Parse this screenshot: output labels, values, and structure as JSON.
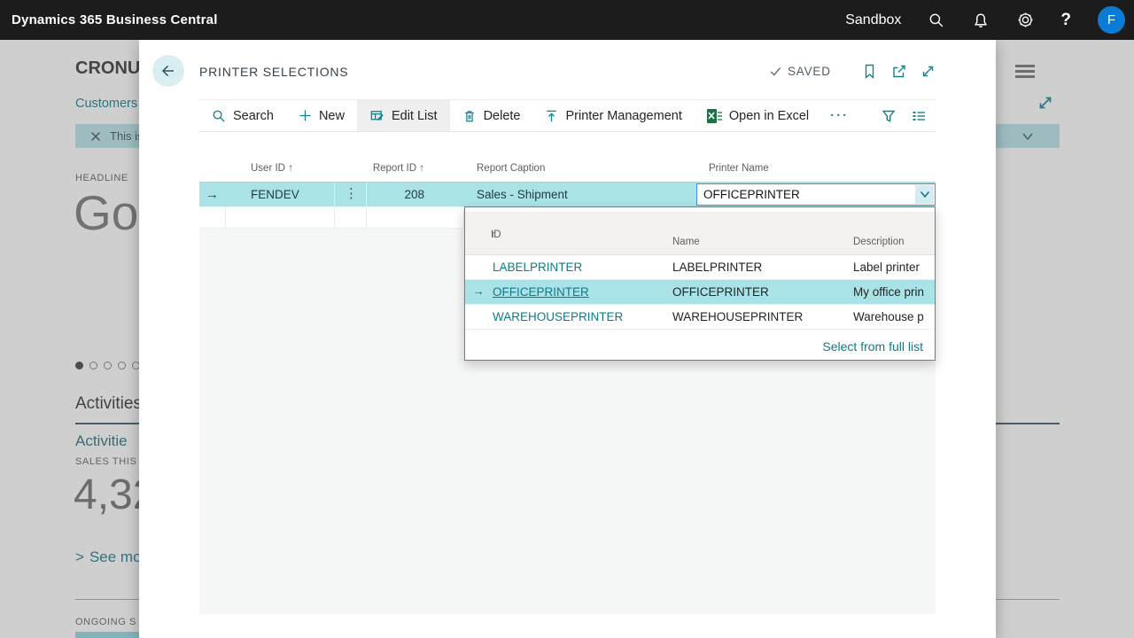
{
  "topbar": {
    "app_title": "Dynamics 365 Business Central",
    "environment": "Sandbox",
    "avatar_initial": "F",
    "icons": [
      "search-icon",
      "notifications-bell-icon",
      "settings-gear-icon",
      "help-question-icon"
    ]
  },
  "background": {
    "company": "CRONUS",
    "nav_link": "Customers",
    "banner_text": "This is",
    "headline_label": "HEADLINE",
    "headline_text": "Goo",
    "activities_heading": "Activities",
    "activities_subheading": "Activitie",
    "sales_label": "SALES THIS",
    "sales_value": "4,32",
    "see_more_label": "See mor",
    "ongoing_label": "ONGOING S"
  },
  "page": {
    "title": "PRINTER SELECTIONS",
    "save_status": "SAVED",
    "toolbar": {
      "search": "Search",
      "new": "New",
      "edit_list": "Edit List",
      "delete": "Delete",
      "printer_management": "Printer Management",
      "open_in_excel": "Open in Excel",
      "more": "···"
    },
    "table": {
      "headers": {
        "user_id": "User ID",
        "report_id": "Report ID",
        "report_caption": "Report Caption",
        "printer_name": "Printer Name"
      },
      "row": {
        "user_id": "FENDEV",
        "report_id": "208",
        "report_caption": "Sales - Shipment",
        "printer_name": "OFFICEPRINTER"
      }
    },
    "dropdown": {
      "headers": {
        "id": "ID",
        "name": "Name",
        "description": "Description"
      },
      "rows": [
        {
          "id": "LABELPRINTER",
          "name": "LABELPRINTER",
          "description": "Label printer"
        },
        {
          "id": "OFFICEPRINTER",
          "name": "OFFICEPRINTER",
          "description": "My office prin"
        },
        {
          "id": "WAREHOUSEPRINTER",
          "name": "WAREHOUSEPRINTER",
          "description": "Warehouse p"
        }
      ],
      "footer_link": "Select from full list"
    }
  },
  "glyphs": {
    "sort_ascending": "↑",
    "row_marker": "→",
    "row_options": "⋮",
    "see_more_chevron": ">"
  },
  "colors": {
    "accent_teal": "#15828f",
    "link_teal": "#0e7c87",
    "row_highlight": "#a9e3e8",
    "focus_border": "#3e97d4",
    "excel_green": "#1e7145",
    "avatar_blue": "#0a7cd7",
    "topbar_bg": "#1c1c1c"
  }
}
